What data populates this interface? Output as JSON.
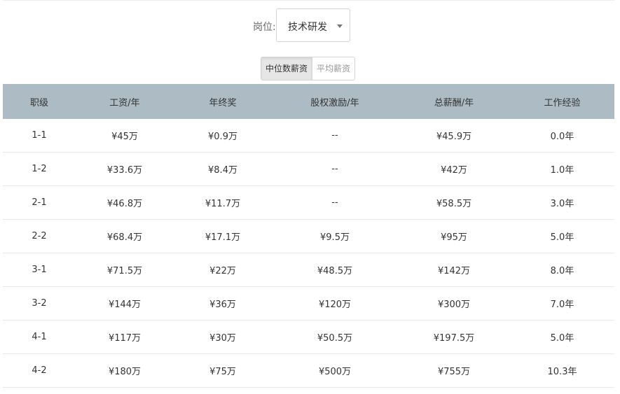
{
  "filter": {
    "label": "岗位:",
    "selected": "技术研发"
  },
  "toggle": {
    "active_label": "中位数薪资",
    "inactive_label": "平均薪资"
  },
  "table": {
    "headers": [
      "职级",
      "工资/年",
      "年终奖",
      "股权激励/年",
      "总薪酬/年",
      "工作经验"
    ],
    "rows": [
      [
        "1-1",
        "¥45万",
        "¥0.9万",
        "--",
        "¥45.9万",
        "0.0年"
      ],
      [
        "1-2",
        "¥33.6万",
        "¥8.4万",
        "--",
        "¥42万",
        "1.0年"
      ],
      [
        "2-1",
        "¥46.8万",
        "¥11.7万",
        "--",
        "¥58.5万",
        "3.0年"
      ],
      [
        "2-2",
        "¥68.4万",
        "¥17.1万",
        "¥9.5万",
        "¥95万",
        "5.0年"
      ],
      [
        "3-1",
        "¥71.5万",
        "¥22万",
        "¥48.5万",
        "¥142万",
        "8.0年"
      ],
      [
        "3-2",
        "¥144万",
        "¥36万",
        "¥120万",
        "¥300万",
        "7.0年"
      ],
      [
        "4-1",
        "¥117万",
        "¥30万",
        "¥50.5万",
        "¥197.5万",
        "5.0年"
      ],
      [
        "4-2",
        "¥180万",
        "¥75万",
        "¥500万",
        "¥755万",
        "10.3年"
      ]
    ]
  },
  "colors": {
    "header_bg": "#adbcc4",
    "row_border": "#e8e8e8",
    "active_toggle_bg": "#e6e6e6"
  }
}
